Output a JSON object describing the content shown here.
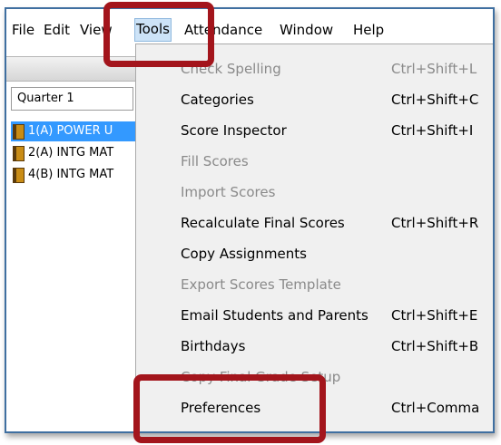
{
  "menubar": {
    "items": [
      "File",
      "Edit",
      "View",
      "Tools",
      "Attendance",
      "Window",
      "Help"
    ],
    "active": "Tools"
  },
  "sidebar": {
    "term": "Quarter 1",
    "classes": [
      {
        "label": "1(A) POWER U",
        "selected": true
      },
      {
        "label": "2(A) INTG MAT",
        "selected": false
      },
      {
        "label": "4(B) INTG MAT",
        "selected": false
      }
    ]
  },
  "tools_menu": {
    "items": [
      {
        "label": "Check Spelling",
        "shortcut": "Ctrl+Shift+L",
        "enabled": false
      },
      {
        "label": "Categories",
        "shortcut": "Ctrl+Shift+C",
        "enabled": true
      },
      {
        "label": "Score Inspector",
        "shortcut": "Ctrl+Shift+I",
        "enabled": true
      },
      {
        "label": "Fill Scores",
        "shortcut": "",
        "enabled": false
      },
      {
        "label": "Import Scores",
        "shortcut": "",
        "enabled": false
      },
      {
        "label": "Recalculate Final Scores",
        "shortcut": "Ctrl+Shift+R",
        "enabled": true
      },
      {
        "label": "Copy Assignments",
        "shortcut": "",
        "enabled": true
      },
      {
        "label": "Export Scores Template",
        "shortcut": "",
        "enabled": false
      },
      {
        "label": "Email Students and Parents",
        "shortcut": "Ctrl+Shift+E",
        "enabled": true
      },
      {
        "label": "Birthdays",
        "shortcut": "Ctrl+Shift+B",
        "enabled": true
      },
      {
        "label": "Copy Final Grade Setup",
        "shortcut": "",
        "enabled": false
      },
      {
        "label": "Preferences",
        "shortcut": "Ctrl+Comma",
        "enabled": true
      }
    ]
  },
  "colors": {
    "highlight": "#a3151c",
    "selection": "#3399ff",
    "menu_background": "#f0f0f0",
    "disabled_text": "#8a8a8a"
  }
}
